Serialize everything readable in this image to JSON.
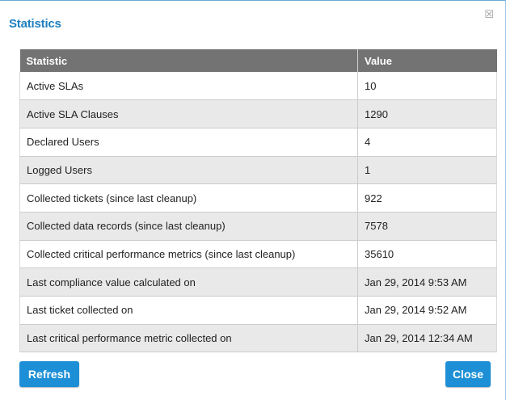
{
  "dialog": {
    "title": "Statistics",
    "close_icon": "close-icon"
  },
  "table": {
    "headers": [
      "Statistic",
      "Value"
    ],
    "rows": [
      [
        "Active SLAs",
        "10"
      ],
      [
        "Active SLA Clauses",
        "1290"
      ],
      [
        "Declared Users",
        "4"
      ],
      [
        "Logged Users",
        "1"
      ],
      [
        "Collected tickets (since last cleanup)",
        "922"
      ],
      [
        "Collected data records (since last cleanup)",
        "7578"
      ],
      [
        "Collected critical performance metrics (since last cleanup)",
        "35610"
      ],
      [
        "Last compliance value calculated on",
        "Jan 29, 2014 9:53 AM"
      ],
      [
        "Last ticket collected on",
        "Jan 29, 2014 9:52 AM"
      ],
      [
        "Last critical performance metric collected on",
        "Jan 29, 2014 12:34 AM"
      ]
    ]
  },
  "buttons": {
    "refresh_label": "Refresh",
    "close_label": "Close"
  },
  "colors": {
    "accent": "#1c8fd6",
    "title": "#1f7fbf",
    "header_bg": "#737373",
    "row_alt": "#e9e9e9"
  }
}
